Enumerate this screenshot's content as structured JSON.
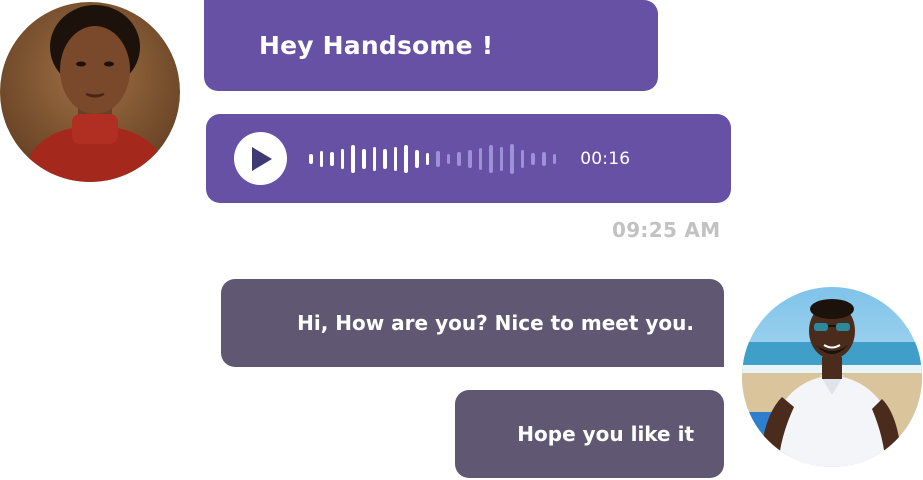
{
  "messages": {
    "greeting": "Hey Handsome !",
    "voice_duration": "00:16",
    "timestamp": "09:25 AM",
    "reply_1": "Hi, How are you? Nice to meet you.",
    "reply_2": "Hope you like it"
  },
  "icons": {
    "play": "play-icon",
    "waveform": "audio-waveform-icon"
  },
  "colors": {
    "incoming_bubble": "#6751a5",
    "outgoing_bubble": "#605872",
    "waveform_played": "#ffffff",
    "waveform_unplayed": "#9d92d9",
    "timestamp_text": "#c2c2c2",
    "play_icon": "#3f3a73"
  }
}
